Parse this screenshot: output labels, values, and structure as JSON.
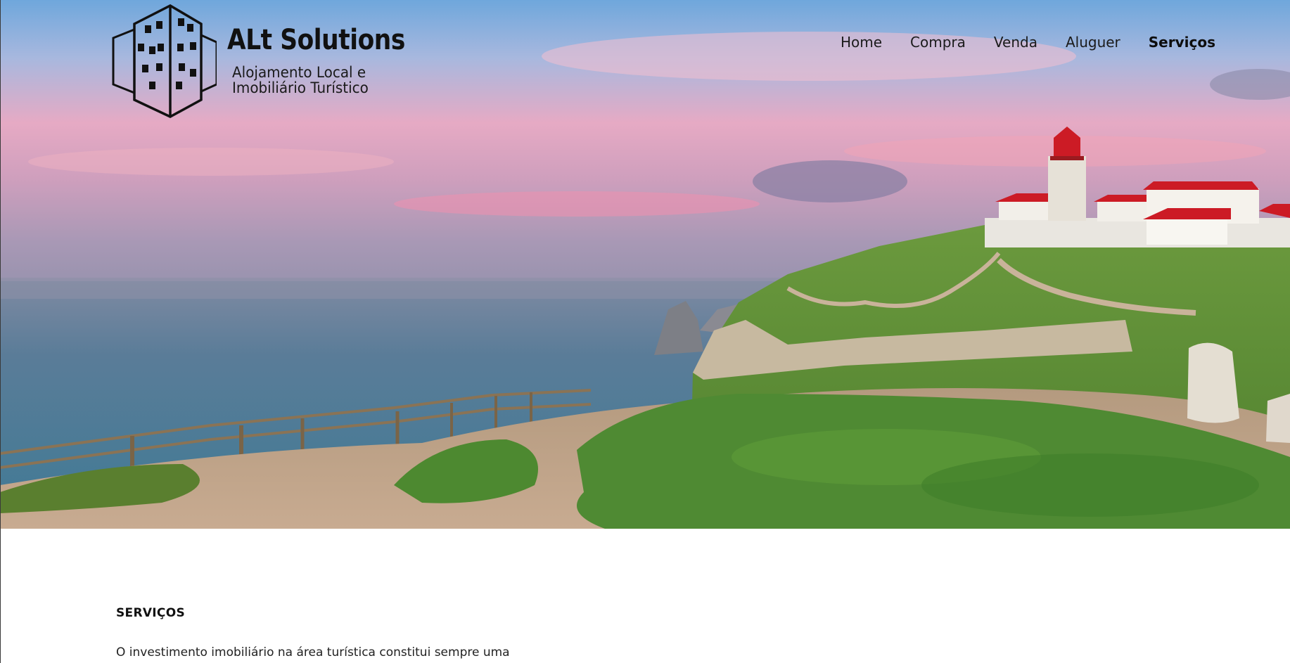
{
  "brand": {
    "title": "ALt Solutions",
    "subtitle_line1": "Alojamento Local  e",
    "subtitle_line2": "Imobiliário Turístico"
  },
  "nav": {
    "items": [
      {
        "label": "Home",
        "active": false
      },
      {
        "label": "Compra",
        "active": false
      },
      {
        "label": "Venda",
        "active": false
      },
      {
        "label": "Aluguer",
        "active": false
      },
      {
        "label": "Serviços",
        "active": true
      }
    ]
  },
  "hero": {
    "image": "cliffside-lighthouse-coastal-landscape"
  },
  "section": {
    "title": "SERVIÇOS",
    "text": "O investimento imobiliário na área turística constitui sempre uma"
  },
  "colors": {
    "sky_top": "#7fb0dc",
    "sky_pink": "#e9a9bf",
    "sea": "#4e7f98",
    "grass": "#5e8f3a",
    "roof_red": "#cc1b25",
    "text": "#111111"
  }
}
